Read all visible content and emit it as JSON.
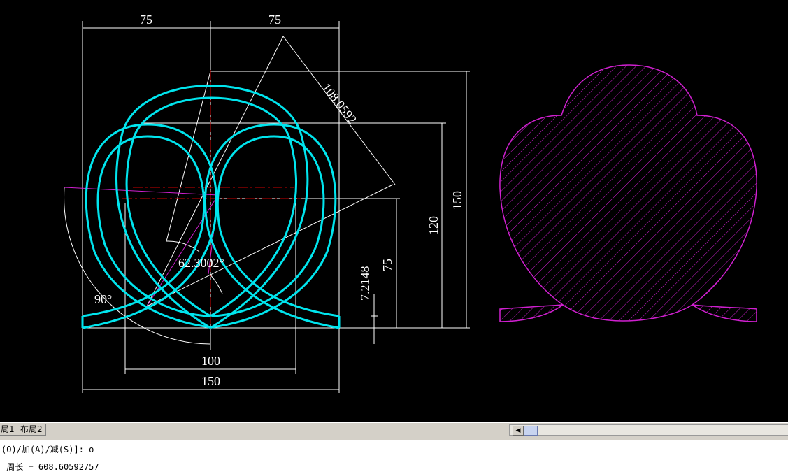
{
  "drawing": {
    "colors": {
      "background": "#000000",
      "curve": "#00e5ee",
      "dimension": "#ffffff",
      "hatch": "#d020d0",
      "centerline": "#cc0000"
    },
    "dimensions": {
      "top_left": "75",
      "top_right": "75",
      "aligned": "108.0592",
      "height_150": "150",
      "height_120": "120",
      "height_75": "75",
      "height_small": "7.2148",
      "angle_main": "62.3002°",
      "angle_90": "90°",
      "width_100": "100",
      "width_150": "150"
    }
  },
  "tabs": {
    "layout1": "局1",
    "layout2": "布局2"
  },
  "scrollbar": {
    "left_arrow_icon": "arrow-left-icon"
  },
  "command": {
    "line1": "(O)/加(A)/减(S)]: o",
    "line2": " 周长 = 608.60592757"
  }
}
